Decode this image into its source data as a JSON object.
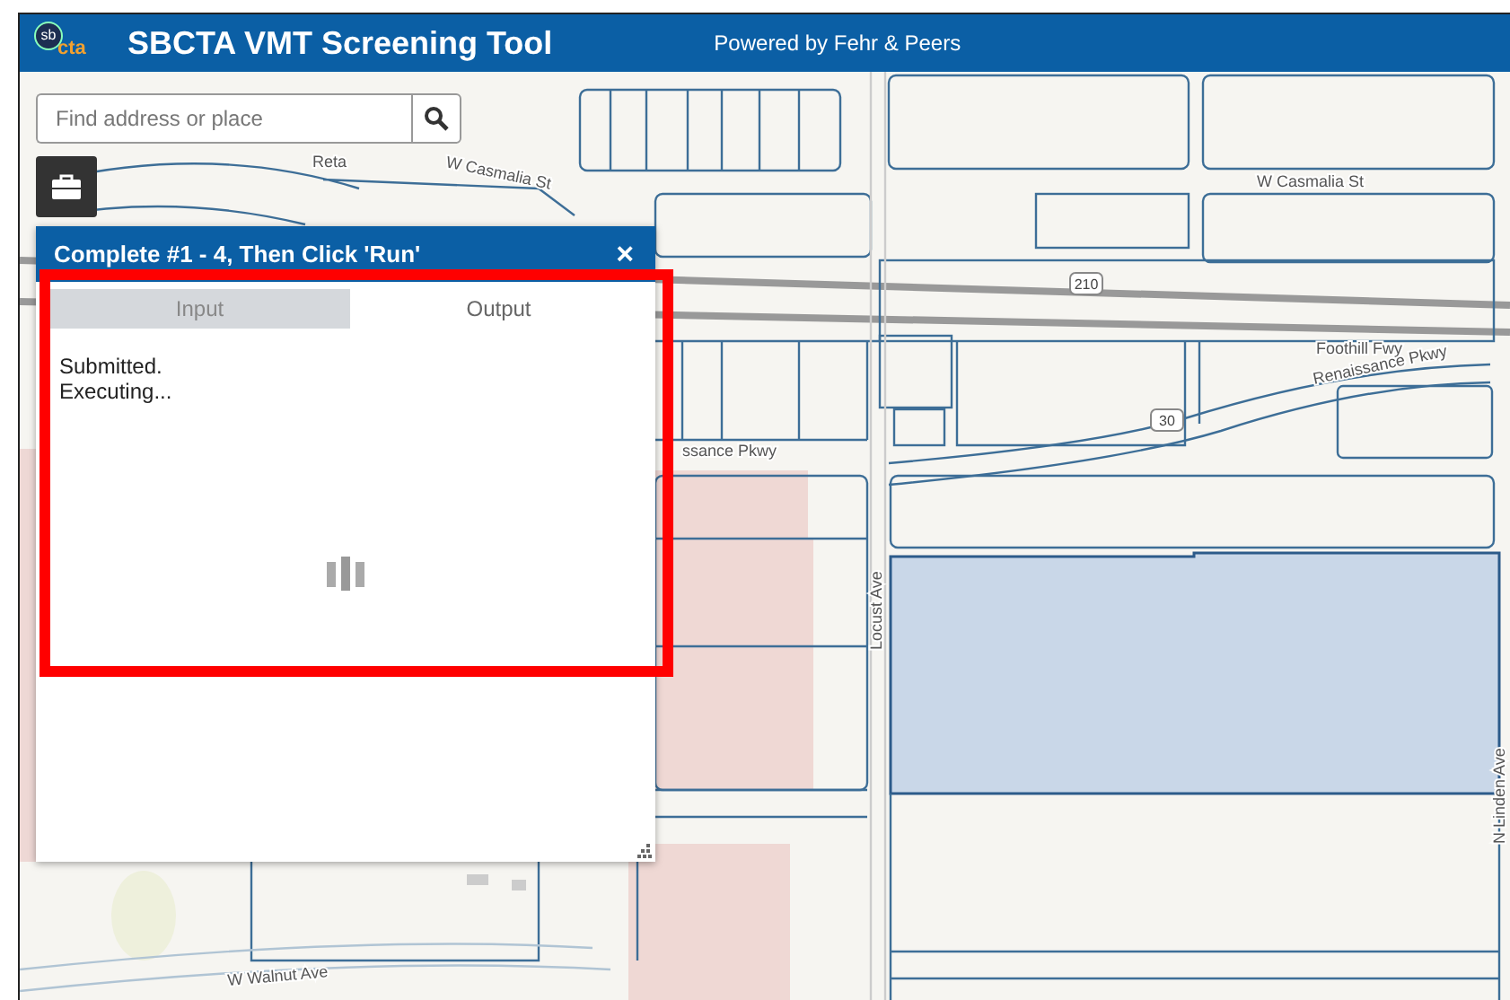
{
  "header": {
    "logo": [
      "sb",
      "cta"
    ],
    "title": "SBCTA VMT Screening Tool",
    "subtitle": "Powered by Fehr & Peers"
  },
  "search": {
    "placeholder": "Find address or place"
  },
  "panel": {
    "title": "Complete #1 - 4, Then Click 'Run'",
    "close": "×",
    "tabs": [
      {
        "label": "Input",
        "selected": false
      },
      {
        "label": "Output",
        "selected": true
      }
    ],
    "messages": [
      "Submitted.",
      "Executing..."
    ]
  },
  "map": {
    "labels": [
      "Reta",
      "W Casmalia St",
      "W Casmalia St",
      "Foothill Fwy",
      "Renaissance Pkwy",
      "ssance Pkwy",
      "Locust Ave",
      "N Linden Ave",
      "W Walnut Ave"
    ],
    "shields": [
      "210",
      "30"
    ]
  }
}
